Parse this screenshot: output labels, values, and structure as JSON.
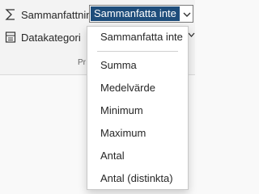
{
  "ribbon": {
    "summary_label": "Sammanfattning",
    "summary_value": "Sammanfatta inte",
    "category_label": "Datakategori",
    "group_label": "Pr"
  },
  "dropdown": {
    "selected": "Sammanfatta inte",
    "options": [
      "Summa",
      "Medelvärde",
      "Minimum",
      "Maximum",
      "Antal",
      "Antal (distinkta)"
    ]
  },
  "colors": {
    "selection": "#1e4d7b"
  },
  "icons": {
    "summary": "sigma-icon",
    "category": "data-category-icon",
    "chevron": "chevron-down-icon"
  }
}
